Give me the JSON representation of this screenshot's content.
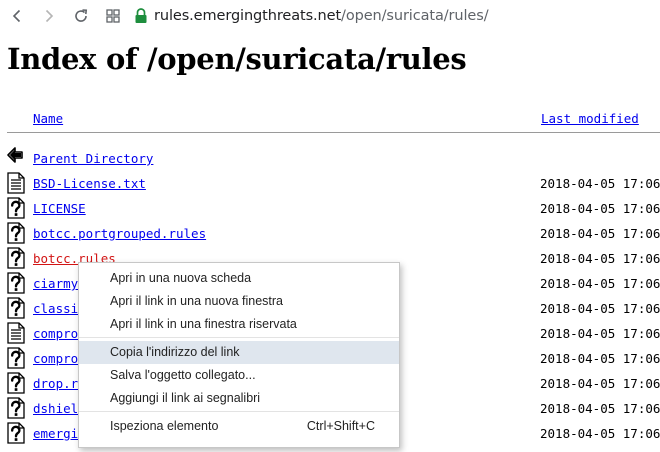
{
  "browser": {
    "url_scheme": "",
    "url_host": "rules.emergingthreats.net",
    "url_path": "/open/suricata/rules/",
    "secure_icon_color": "#1e8e3e"
  },
  "page": {
    "title": "Index of /open/suricata/rules",
    "columns": {
      "name": "Name",
      "last_modified": "Last modified"
    }
  },
  "rows": [
    {
      "name": "Parent Directory",
      "date": "",
      "icon": "back-icon"
    },
    {
      "name": "BSD-License.txt",
      "date": "2018-04-05 17:06",
      "icon": "text-file-icon"
    },
    {
      "name": "LICENSE",
      "date": "2018-04-05 17:06",
      "icon": "unknown-file-icon"
    },
    {
      "name": "botcc.portgrouped.rules",
      "date": "2018-04-05 17:06",
      "icon": "unknown-file-icon"
    },
    {
      "name": "botcc.rules",
      "date": "2018-04-05 17:06",
      "icon": "unknown-file-icon",
      "visited": true
    },
    {
      "name": "ciarmy",
      "date": "2018-04-05 17:06",
      "icon": "unknown-file-icon"
    },
    {
      "name": "classif",
      "date": "2018-04-05 17:06",
      "icon": "unknown-file-icon"
    },
    {
      "name": "compro",
      "date": "2018-04-05 17:06",
      "icon": "text-file-icon"
    },
    {
      "name": "compro",
      "date": "2018-04-05 17:06",
      "icon": "unknown-file-icon"
    },
    {
      "name": "drop.r",
      "date": "2018-04-05 17:06",
      "icon": "unknown-file-icon"
    },
    {
      "name": "dshiel",
      "date": "2018-04-05 17:06",
      "icon": "unknown-file-icon"
    },
    {
      "name": "emergi",
      "date": "2018-04-05 17:06",
      "icon": "unknown-file-icon"
    }
  ],
  "context_menu": {
    "items": [
      {
        "label": "Apri in una nuova scheda",
        "shortcut": ""
      },
      {
        "label": "Apri il link in una nuova finestra",
        "shortcut": ""
      },
      {
        "label": "Apri il link in una finestra riservata",
        "shortcut": ""
      },
      {
        "label": "Copia l'indirizzo del link",
        "shortcut": "",
        "highlighted": true
      },
      {
        "label": "Salva l'oggetto collegato...",
        "shortcut": ""
      },
      {
        "label": "Aggiungi il link ai segnalibri",
        "shortcut": ""
      },
      {
        "label": "Ispeziona elemento",
        "shortcut": "Ctrl+Shift+C"
      }
    ]
  },
  "colors": {
    "link": "#0000ee",
    "visited_link": "#d21414",
    "menu_highlight": "#dfe6ee"
  }
}
